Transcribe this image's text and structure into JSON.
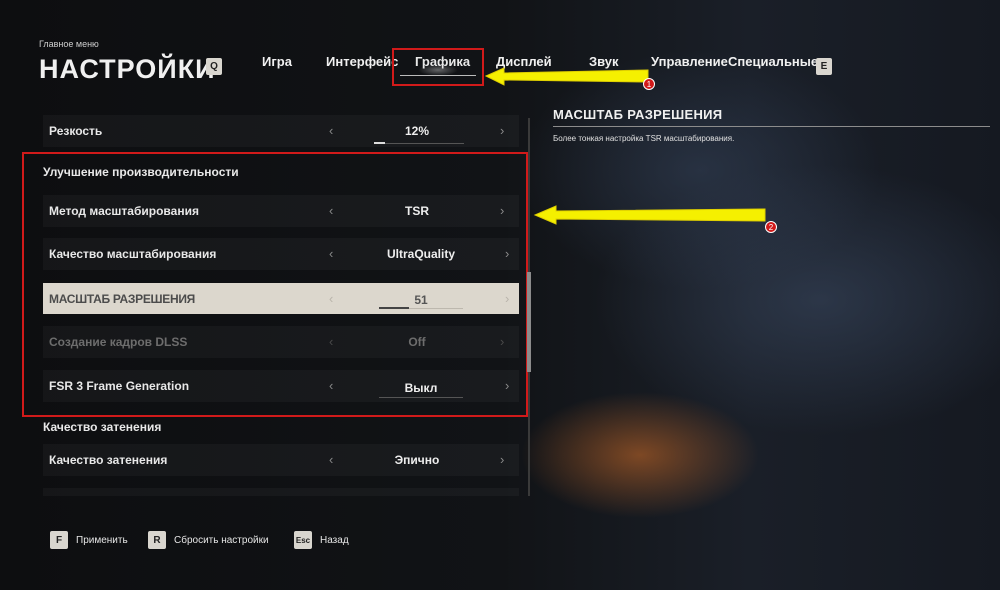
{
  "header": {
    "breadcrumb": "Главное меню",
    "title": "НАСТРОЙКИ",
    "prev_key": "Q",
    "next_key": "E",
    "tabs": [
      {
        "label": "Игра"
      },
      {
        "label": "Интерфейс"
      },
      {
        "label": "Графика",
        "active": true
      },
      {
        "label": "Дисплей"
      },
      {
        "label": "Звук"
      },
      {
        "label": "Управление"
      },
      {
        "label": "Специальные"
      }
    ]
  },
  "settings": {
    "sharpness": {
      "label": "Резкость",
      "value": "12%",
      "slider_fraction": 0.12
    },
    "perf_section": "Улучшение производительности",
    "upscale_method": {
      "label": "Метод масштабирования",
      "value": "TSR"
    },
    "upscale_quality": {
      "label": "Качество масштабирования",
      "value": "UltraQuality"
    },
    "resolution_scale": {
      "label": "МАСШТАБ РАЗРЕШЕНИЯ",
      "value": "51",
      "slider_fraction": 0.37
    },
    "dlss_frame_gen": {
      "label": "Создание кадров DLSS",
      "value": "Off"
    },
    "fsr3_frame_gen": {
      "label": "FSR 3 Frame Generation",
      "value": "Выкл"
    },
    "shading_section": "Качество затенения",
    "shading_quality": {
      "label": "Качество затенения",
      "value": "Эпично"
    }
  },
  "description": {
    "title": "МАСШТАБ РАЗРЕШЕНИЯ",
    "text": "Более тонкая настройка TSR масштабирования."
  },
  "footer": {
    "apply": {
      "key": "F",
      "label": "Применить"
    },
    "reset": {
      "key": "R",
      "label": "Сбросить настройки"
    },
    "back": {
      "key": "Esc",
      "label": "Назад"
    }
  },
  "annotations": {
    "badge_1": "1",
    "badge_2": "2",
    "highlight_color": "#d11a1a",
    "arrow_color": "#f5f000"
  }
}
